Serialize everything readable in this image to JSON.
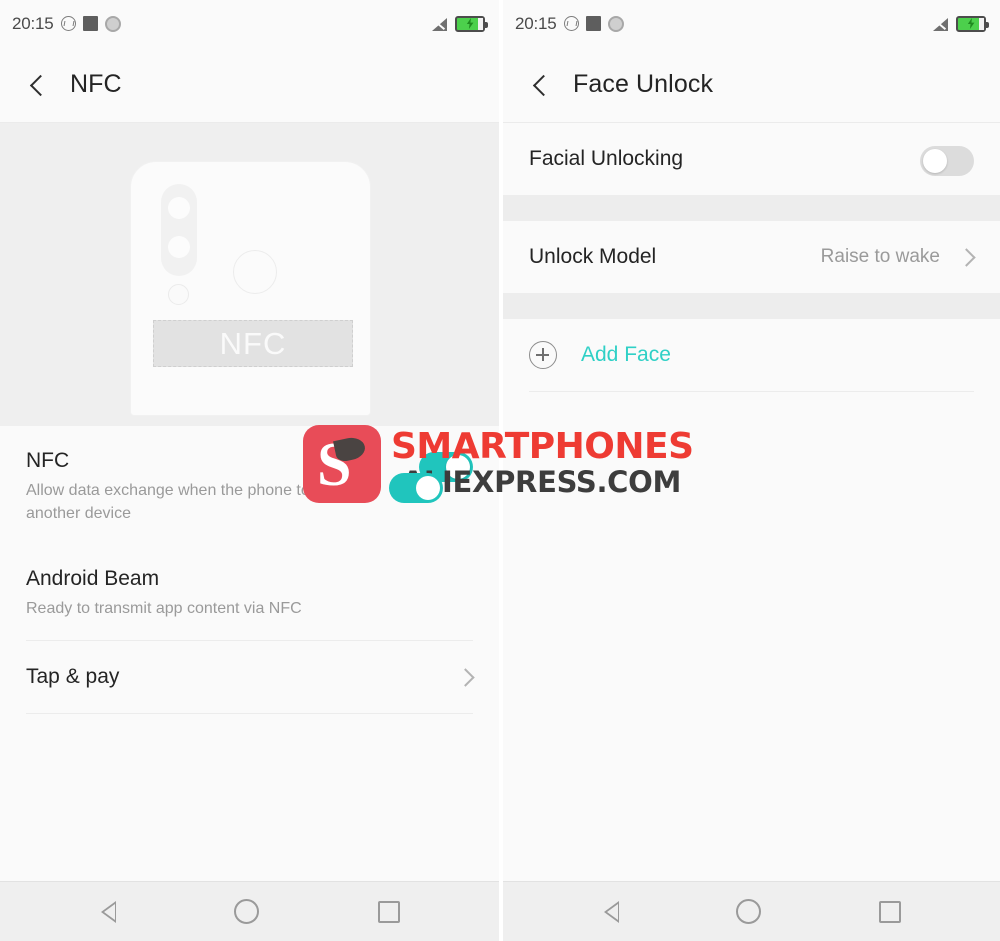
{
  "statusbar": {
    "time": "20:15",
    "icons_left": [
      "dnd-circle-icon",
      "square-dark-icon",
      "ring-circle-icon"
    ],
    "icons_right": [
      "signal-off-icon",
      "battery-charging-icon"
    ]
  },
  "colors": {
    "accent_teal": "#20c5bd",
    "add_face_teal": "#2fd0c6",
    "battery_green": "#4cd04c",
    "watermark_red": "#ee3b33",
    "watermark_mark": "#e84c58",
    "page_bg": "#fafafa",
    "section_gap": "#ededed",
    "illustration_bg": "#efefef"
  },
  "left_panel": {
    "appbar": {
      "back_label": "back",
      "title": "NFC"
    },
    "illustration": {
      "nfc_zone_label": "NFC",
      "parts": [
        "phone-back",
        "dual-camera-module",
        "flash",
        "fingerprint-sensor",
        "nfc-zone"
      ]
    },
    "rows": [
      {
        "title": "NFC",
        "subtitle": "Allow data exchange when the phone touches another device",
        "control": "toggle",
        "toggle_state": "on"
      },
      {
        "title": "Android Beam",
        "subtitle": "Ready to transmit app content via NFC",
        "control": "none"
      },
      {
        "title": "Tap & pay",
        "subtitle": "",
        "control": "chevron"
      }
    ]
  },
  "right_panel": {
    "appbar": {
      "back_label": "back",
      "title": "Face Unlock"
    },
    "rows": [
      {
        "title": "Facial Unlocking",
        "control": "toggle",
        "toggle_state": "off"
      },
      {
        "title": "Unlock Model",
        "value": "Raise to wake",
        "control": "chevron"
      },
      {
        "title": "Add Face",
        "control": "plus-icon"
      }
    ]
  },
  "navbar": {
    "back": "back-triangle-icon",
    "home": "home-circle-icon",
    "recents": "recents-square-icon"
  },
  "watermark": {
    "line1": "SMARTPHONES",
    "line2": ".ALIEXPRESS.COM",
    "mark_letter": "S"
  }
}
